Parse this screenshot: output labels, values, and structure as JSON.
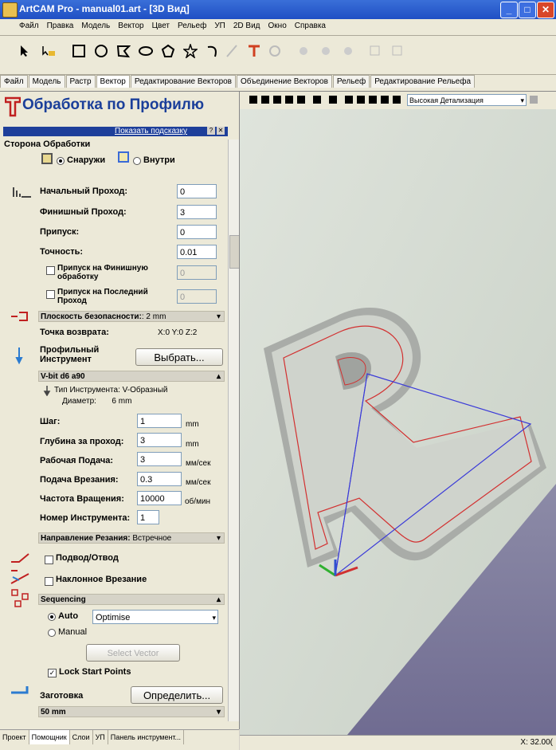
{
  "window": {
    "title": "ArtCAM Pro - manual01.art - [3D Вид]",
    "min": "_",
    "max": "□",
    "close": "✕"
  },
  "menu": [
    "Файл",
    "Правка",
    "Модель",
    "Вектор",
    "Цвет",
    "Рельеф",
    "УП",
    "2D Вид",
    "Окно",
    "Справка"
  ],
  "toptabs": [
    "Файл",
    "Модель",
    "Растр",
    "Вектор",
    "Редактирование Векторов",
    "Объединение Векторов",
    "Рельеф",
    "Редактирование Рельефа"
  ],
  "panel": {
    "title": "Обработка по Профилю",
    "hint": "Показать подсказку",
    "side_header": "Сторона Обработки",
    "outside": "Снаружи",
    "inside": "Внутри",
    "start_pass_label": "Начальный Проход:",
    "start_pass": "0",
    "finish_pass_label": "Финишный Проход:",
    "finish_pass": "3",
    "allowance_label": "Припуск:",
    "allowance": "0",
    "tolerance_label": "Точность:",
    "tolerance": "0.01",
    "finish_allow_label": "Припуск на Финишную обработку",
    "finish_allow": "0",
    "last_pass_label": "Припуск на Последний Проход",
    "last_pass": "0",
    "safe_z_label": "Плоскость безопасности:",
    "safe_z_value": ": 2 mm",
    "home_label": "Точка возврата:",
    "home_value": "X:0 Y:0 Z:2",
    "tool_label": "Профильный Инструмент",
    "select_btn": "Выбрать...",
    "tool_name": "V-bit d6 a90",
    "tool_type": "Тип Инструмента: V-Образный",
    "tool_diam": "Диаметр:       6 mm",
    "step_label": "Шаг:",
    "step": "1",
    "step_unit": "mm",
    "depth_label": "Глубина за проход:",
    "depth": "3",
    "depth_unit": "mm",
    "feed_label": "Рабочая Подача:",
    "feed": "3",
    "feed_unit": "мм/сек",
    "plunge_label": "Подача Врезания:",
    "plunge": "0.3",
    "plunge_unit": "мм/сек",
    "spindle_label": "Частота Вращения:",
    "spindle": "10000",
    "spindle_unit": "об/мин",
    "toolnum_label": "Номер Инструмента:",
    "toolnum": "1",
    "cut_dir_label": "Направление Резания:",
    "cut_dir_value": "Встречное",
    "leadin": "Подвод/Отвод",
    "ramp": "Наклонное Врезание",
    "sequencing": "Sequencing",
    "auto": "Auto",
    "auto_option": "Optimise",
    "manual": "Manual",
    "select_vector": "Select Vector",
    "lock_start": "Lock Start Points",
    "stock_label": "Заготовка",
    "define_btn": "Определить...",
    "stock_value": "50 mm"
  },
  "bottomtabs": [
    "Проект",
    "Помощник",
    "Слои",
    "УП",
    "Панель инструмент..."
  ],
  "view": {
    "detail": "Высокая Детализация"
  },
  "status": {
    "coord": "X: 32.00("
  },
  "colors": {
    "accent": "#1e3f9a",
    "toolpath": "#d23030",
    "rapid": "#3a3ad8"
  }
}
